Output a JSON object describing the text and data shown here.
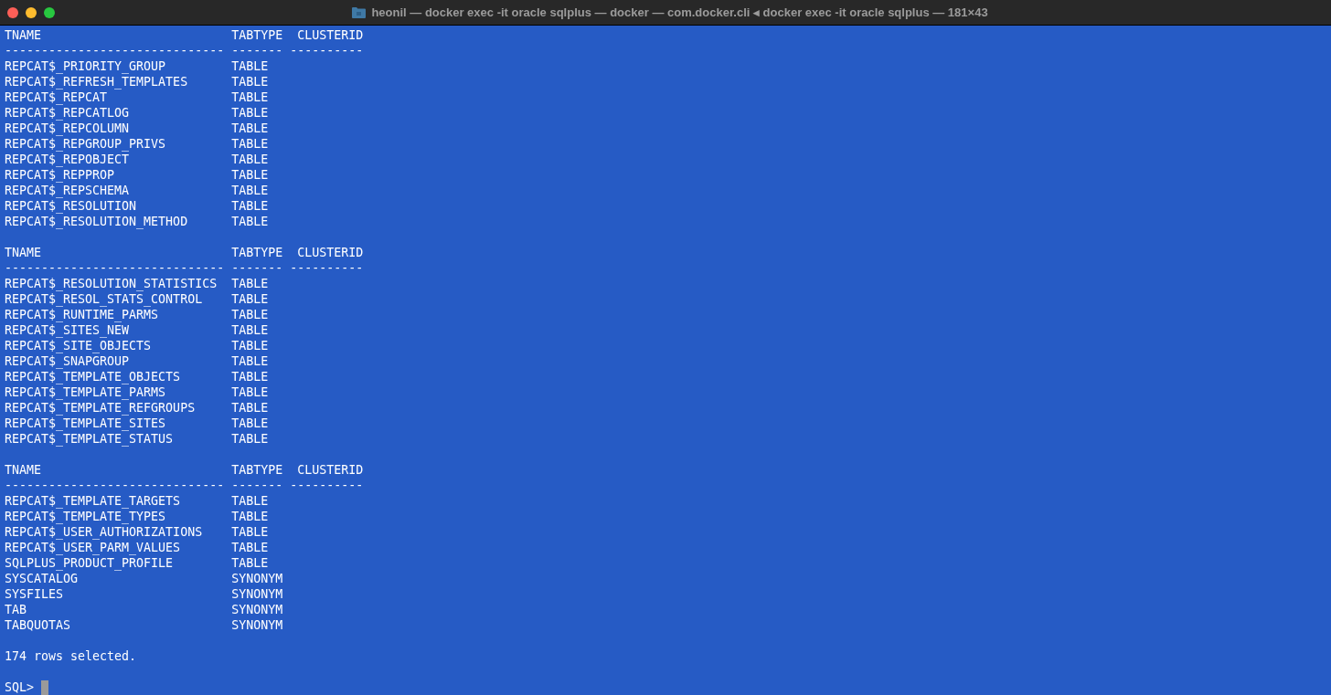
{
  "window": {
    "title": "heonil — docker exec -it oracle sqlplus — docker — com.docker.cli ◂ docker exec -it oracle sqlplus — 181×43"
  },
  "blocks": [
    {
      "columns": [
        {
          "heading": "TNAME",
          "rule": "------------------------------"
        },
        {
          "heading": "TABTYPE",
          "rule": "-------"
        },
        {
          "heading": "CLUSTERID",
          "rule": "----------"
        }
      ],
      "rows": [
        {
          "tname": "REPCAT$_PRIORITY_GROUP",
          "tabtype": "TABLE"
        },
        {
          "tname": "REPCAT$_REFRESH_TEMPLATES",
          "tabtype": "TABLE"
        },
        {
          "tname": "REPCAT$_REPCAT",
          "tabtype": "TABLE"
        },
        {
          "tname": "REPCAT$_REPCATLOG",
          "tabtype": "TABLE"
        },
        {
          "tname": "REPCAT$_REPCOLUMN",
          "tabtype": "TABLE"
        },
        {
          "tname": "REPCAT$_REPGROUP_PRIVS",
          "tabtype": "TABLE"
        },
        {
          "tname": "REPCAT$_REPOBJECT",
          "tabtype": "TABLE"
        },
        {
          "tname": "REPCAT$_REPPROP",
          "tabtype": "TABLE"
        },
        {
          "tname": "REPCAT$_REPSCHEMA",
          "tabtype": "TABLE"
        },
        {
          "tname": "REPCAT$_RESOLUTION",
          "tabtype": "TABLE"
        },
        {
          "tname": "REPCAT$_RESOLUTION_METHOD",
          "tabtype": "TABLE"
        }
      ]
    },
    {
      "columns": [
        {
          "heading": "TNAME",
          "rule": "------------------------------"
        },
        {
          "heading": "TABTYPE",
          "rule": "-------"
        },
        {
          "heading": "CLUSTERID",
          "rule": "----------"
        }
      ],
      "rows": [
        {
          "tname": "REPCAT$_RESOLUTION_STATISTICS",
          "tabtype": "TABLE"
        },
        {
          "tname": "REPCAT$_RESOL_STATS_CONTROL",
          "tabtype": "TABLE"
        },
        {
          "tname": "REPCAT$_RUNTIME_PARMS",
          "tabtype": "TABLE"
        },
        {
          "tname": "REPCAT$_SITES_NEW",
          "tabtype": "TABLE"
        },
        {
          "tname": "REPCAT$_SITE_OBJECTS",
          "tabtype": "TABLE"
        },
        {
          "tname": "REPCAT$_SNAPGROUP",
          "tabtype": "TABLE"
        },
        {
          "tname": "REPCAT$_TEMPLATE_OBJECTS",
          "tabtype": "TABLE"
        },
        {
          "tname": "REPCAT$_TEMPLATE_PARMS",
          "tabtype": "TABLE"
        },
        {
          "tname": "REPCAT$_TEMPLATE_REFGROUPS",
          "tabtype": "TABLE"
        },
        {
          "tname": "REPCAT$_TEMPLATE_SITES",
          "tabtype": "TABLE"
        },
        {
          "tname": "REPCAT$_TEMPLATE_STATUS",
          "tabtype": "TABLE"
        }
      ]
    },
    {
      "columns": [
        {
          "heading": "TNAME",
          "rule": "------------------------------"
        },
        {
          "heading": "TABTYPE",
          "rule": "-------"
        },
        {
          "heading": "CLUSTERID",
          "rule": "----------"
        }
      ],
      "rows": [
        {
          "tname": "REPCAT$_TEMPLATE_TARGETS",
          "tabtype": "TABLE"
        },
        {
          "tname": "REPCAT$_TEMPLATE_TYPES",
          "tabtype": "TABLE"
        },
        {
          "tname": "REPCAT$_USER_AUTHORIZATIONS",
          "tabtype": "TABLE"
        },
        {
          "tname": "REPCAT$_USER_PARM_VALUES",
          "tabtype": "TABLE"
        },
        {
          "tname": "SQLPLUS_PRODUCT_PROFILE",
          "tabtype": "TABLE"
        },
        {
          "tname": "SYSCATALOG",
          "tabtype": "SYNONYM"
        },
        {
          "tname": "SYSFILES",
          "tabtype": "SYNONYM"
        },
        {
          "tname": "TAB",
          "tabtype": "SYNONYM"
        },
        {
          "tname": "TABQUOTAS",
          "tabtype": "SYNONYM"
        }
      ]
    }
  ],
  "footer": "174 rows selected.",
  "prompt": "SQL>"
}
